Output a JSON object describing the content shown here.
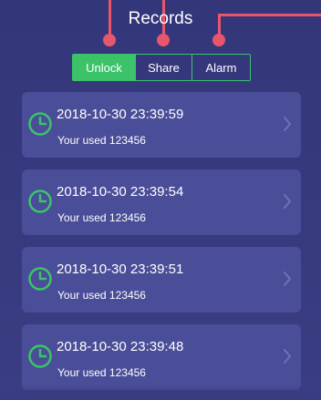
{
  "header": {
    "title": "Records"
  },
  "tabs": [
    {
      "label": "Unlock",
      "active": true
    },
    {
      "label": "Share",
      "active": false
    },
    {
      "label": "Alarm",
      "active": false
    }
  ],
  "records": [
    {
      "time": "2018-10-30 23:39:59",
      "detail": "Your used 123456",
      "icon": "clock-icon"
    },
    {
      "time": "2018-10-30 23:39:54",
      "detail": "Your used 123456",
      "icon": "clock-icon"
    },
    {
      "time": "2018-10-30 23:39:51",
      "detail": "Your used 123456",
      "icon": "clock-icon"
    },
    {
      "time": "2018-10-30 23:39:48",
      "detail": "Your used 123456",
      "icon": "clock-icon"
    }
  ],
  "colors": {
    "background": "#3a3c82",
    "card": "#4a4d98",
    "accent_green": "#3cc36a",
    "annotation_red": "#e8566d"
  }
}
